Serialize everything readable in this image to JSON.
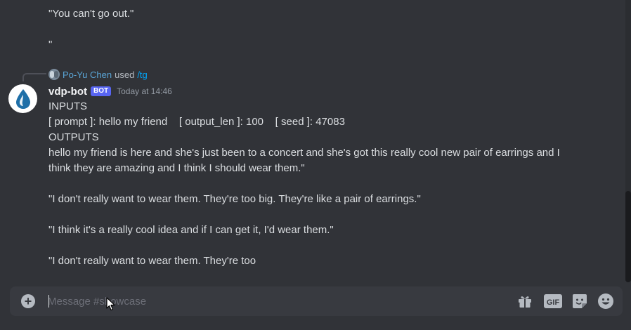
{
  "messages_above": {
    "line1": "\"You can't go out.\"",
    "line2": "\""
  },
  "reply": {
    "user": "Po-Yu Chen",
    "used_text": "used",
    "command": "/tg"
  },
  "message": {
    "author": "vdp-bot",
    "bot_tag": "BOT",
    "timestamp": "Today at 14:46",
    "lines": [
      "INPUTS",
      "[ prompt ]: hello my friend    [ output_len ]: 100    [ seed ]: 47083",
      "OUTPUTS",
      "hello my friend is here and she's just been to a concert and she's got this really cool new pair of earrings and I",
      "think they are amazing and I think I should wear them.\"",
      "\"I don't really want to wear them. They're too big. They're like a pair of earrings.\"",
      "\"I think it's a really cool idea and if I can get it, I'd wear them.\"",
      "\"I don't really want to wear them. They're too"
    ]
  },
  "composer": {
    "placeholder": "Message #showcase",
    "value": ""
  },
  "icons": {
    "add": "plus-circle-icon",
    "gift": "gift-icon",
    "gif": "gif-icon",
    "sticker": "sticker-icon",
    "emoji": "emoji-icon",
    "gif_label": "GIF"
  },
  "colors": {
    "background": "#313338",
    "composer": "#383a40",
    "bot_tag": "#5865f2",
    "link": "#00a8fc"
  }
}
